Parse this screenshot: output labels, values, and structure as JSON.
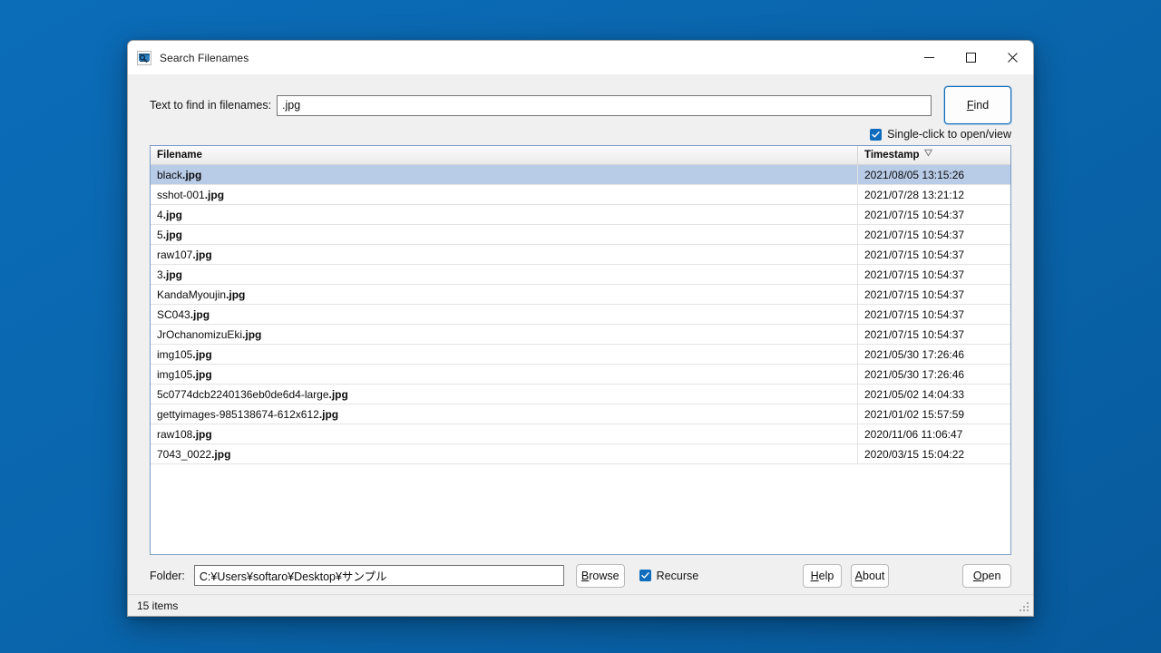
{
  "window": {
    "title": "Search Filenames",
    "icon": "search-filenames-app-icon",
    "controls": {
      "minimize": "—",
      "maximize": "□",
      "close": "✕"
    }
  },
  "search": {
    "label": "Text to find in filenames:",
    "value": ".jpg",
    "placeholder": "",
    "find_button": "Find",
    "find_mnemonic": "F",
    "single_click": {
      "label": "Single-click to open/view",
      "checked": true
    }
  },
  "list": {
    "columns": [
      {
        "key": "filename",
        "label": "Filename"
      },
      {
        "key": "timestamp",
        "label": "Timestamp",
        "sort": "descending",
        "sort_glyph": "▽"
      }
    ],
    "rows": [
      {
        "name": "black",
        "match": ".jpg",
        "timestamp": "2021/08/05 13:15:26",
        "selected": true
      },
      {
        "name": "sshot-001",
        "match": ".jpg",
        "timestamp": "2021/07/28 13:21:12",
        "selected": false
      },
      {
        "name": "4",
        "match": ".jpg",
        "timestamp": "2021/07/15 10:54:37",
        "selected": false
      },
      {
        "name": "5",
        "match": ".jpg",
        "timestamp": "2021/07/15 10:54:37",
        "selected": false
      },
      {
        "name": "raw107",
        "match": ".jpg",
        "timestamp": "2021/07/15 10:54:37",
        "selected": false
      },
      {
        "name": "3",
        "match": ".jpg",
        "timestamp": "2021/07/15 10:54:37",
        "selected": false
      },
      {
        "name": "KandaMyoujin",
        "match": ".jpg",
        "timestamp": "2021/07/15 10:54:37",
        "selected": false
      },
      {
        "name": "SC043",
        "match": ".jpg",
        "timestamp": "2021/07/15 10:54:37",
        "selected": false
      },
      {
        "name": "JrOchanomizuEki",
        "match": ".jpg",
        "timestamp": "2021/07/15 10:54:37",
        "selected": false
      },
      {
        "name": "img105",
        "match": ".jpg",
        "timestamp": "2021/05/30 17:26:46",
        "selected": false
      },
      {
        "name": "img105",
        "match": ".jpg",
        "timestamp": "2021/05/30 17:26:46",
        "selected": false
      },
      {
        "name": "5c0774dcb2240136eb0de6d4-large",
        "match": ".jpg",
        "timestamp": "2021/05/02 14:04:33",
        "selected": false
      },
      {
        "name": "gettyimages-985138674-612x612",
        "match": ".jpg",
        "timestamp": "2021/01/02 15:57:59",
        "selected": false
      },
      {
        "name": "raw108",
        "match": ".jpg",
        "timestamp": "2020/11/06 11:06:47",
        "selected": false
      },
      {
        "name": "7043_0022",
        "match": ".jpg",
        "timestamp": "2020/03/15 15:04:22",
        "selected": false
      }
    ]
  },
  "folder": {
    "label": "Folder:",
    "value": "C:¥Users¥softaro¥Desktop¥サンプル",
    "placeholder": ""
  },
  "buttons": {
    "browse": {
      "label": "Browse",
      "mnemonic": "B"
    },
    "help": {
      "label": "Help",
      "mnemonic": "H"
    },
    "about": {
      "label": "About",
      "mnemonic": "A"
    },
    "open": {
      "label": "Open",
      "mnemonic": "O"
    }
  },
  "recurse": {
    "label": "Recurse",
    "checked": true
  },
  "status": {
    "text": "15 items"
  },
  "colors": {
    "desktop": "#0a6ab5",
    "selection": "#b8cce8",
    "accent": "#0f6cbd",
    "list_border": "#7a9cc4",
    "chrome": "#f0f0f0"
  }
}
